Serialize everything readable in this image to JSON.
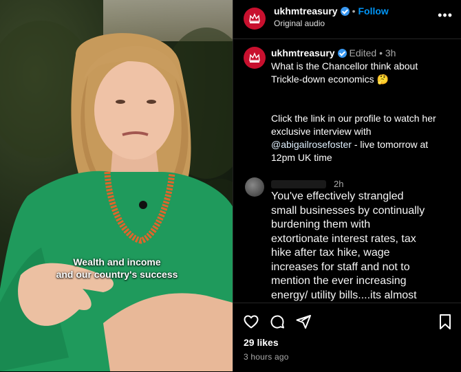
{
  "video": {
    "caption_line1": "Wealth and income",
    "caption_line2": "and our country's success"
  },
  "header": {
    "username": "ukhmtreasury",
    "separator": "•",
    "follow_label": "Follow",
    "audio_label": "Original audio",
    "more_label": "•••"
  },
  "post": {
    "username": "ukhmtreasury",
    "edited": "Edited",
    "separator": "•",
    "time": "3h",
    "line1": "What is the Chancellor think about",
    "line2": "Trickle-down economics 🤔",
    "line3": "Click the link in our profile to watch her",
    "line4": "exclusive interview with",
    "mention": "@abigailrosefoster",
    "line5_suffix": " - live tomorrow at",
    "line6": "12pm UK time"
  },
  "comment": {
    "time": "2h",
    "lines": [
      "You've effectively strangled",
      "small businesses by continually",
      "burdening them with",
      "extortionate interest rates, tax",
      "hike after tax hike, wage",
      "increases for staff and not to",
      "mention the ever increasing",
      "energy/ utility bills....its almost"
    ]
  },
  "footer": {
    "likes": "29 likes",
    "time_ago": "3 hours ago"
  },
  "icons": {
    "like": "heart-icon",
    "comment": "comment-icon",
    "share": "share-icon",
    "save": "bookmark-icon",
    "verified": "verified-badge-icon",
    "more": "more-options-icon"
  },
  "colors": {
    "brand_red": "#c8102e",
    "follow_blue": "#0095f6",
    "verified_blue": "#3897f0",
    "shirt_green": "#1f9a5c"
  }
}
